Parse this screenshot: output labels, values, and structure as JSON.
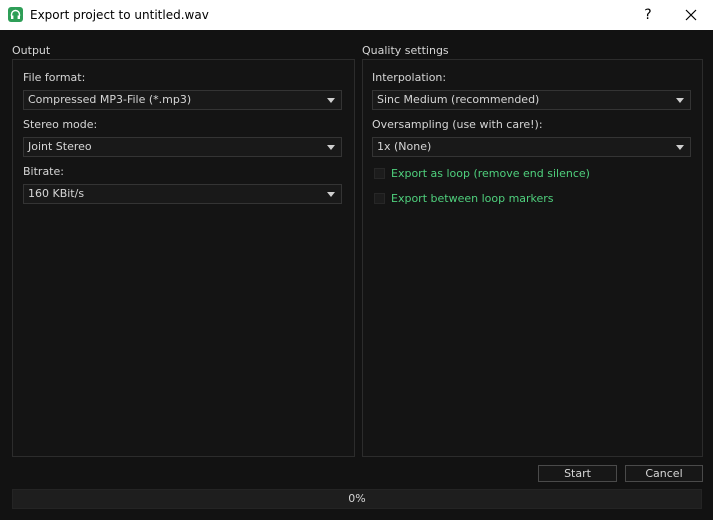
{
  "window": {
    "title": "Export project to untitled.wav",
    "help_label": "?",
    "icon": "app-headphones-icon",
    "accent_color": "#2e9e57"
  },
  "output": {
    "group_title": "Output",
    "file_format": {
      "label": "File format:",
      "value": "Compressed MP3-File (*.mp3)"
    },
    "stereo_mode": {
      "label": "Stereo mode:",
      "value": "Joint Stereo"
    },
    "bitrate": {
      "label": "Bitrate:",
      "value": "160 KBit/s"
    }
  },
  "quality": {
    "group_title": "Quality settings",
    "interpolation": {
      "label": "Interpolation:",
      "value": "Sinc Medium (recommended)"
    },
    "oversampling": {
      "label": "Oversampling (use with care!):",
      "value": "1x (None)"
    },
    "export_loop": {
      "label": "Export as loop (remove end silence)",
      "checked": false
    },
    "export_between_markers": {
      "label": "Export between loop markers",
      "checked": false
    }
  },
  "actions": {
    "start_label": "Start",
    "cancel_label": "Cancel"
  },
  "progress": {
    "value": 0,
    "text": "0%"
  }
}
